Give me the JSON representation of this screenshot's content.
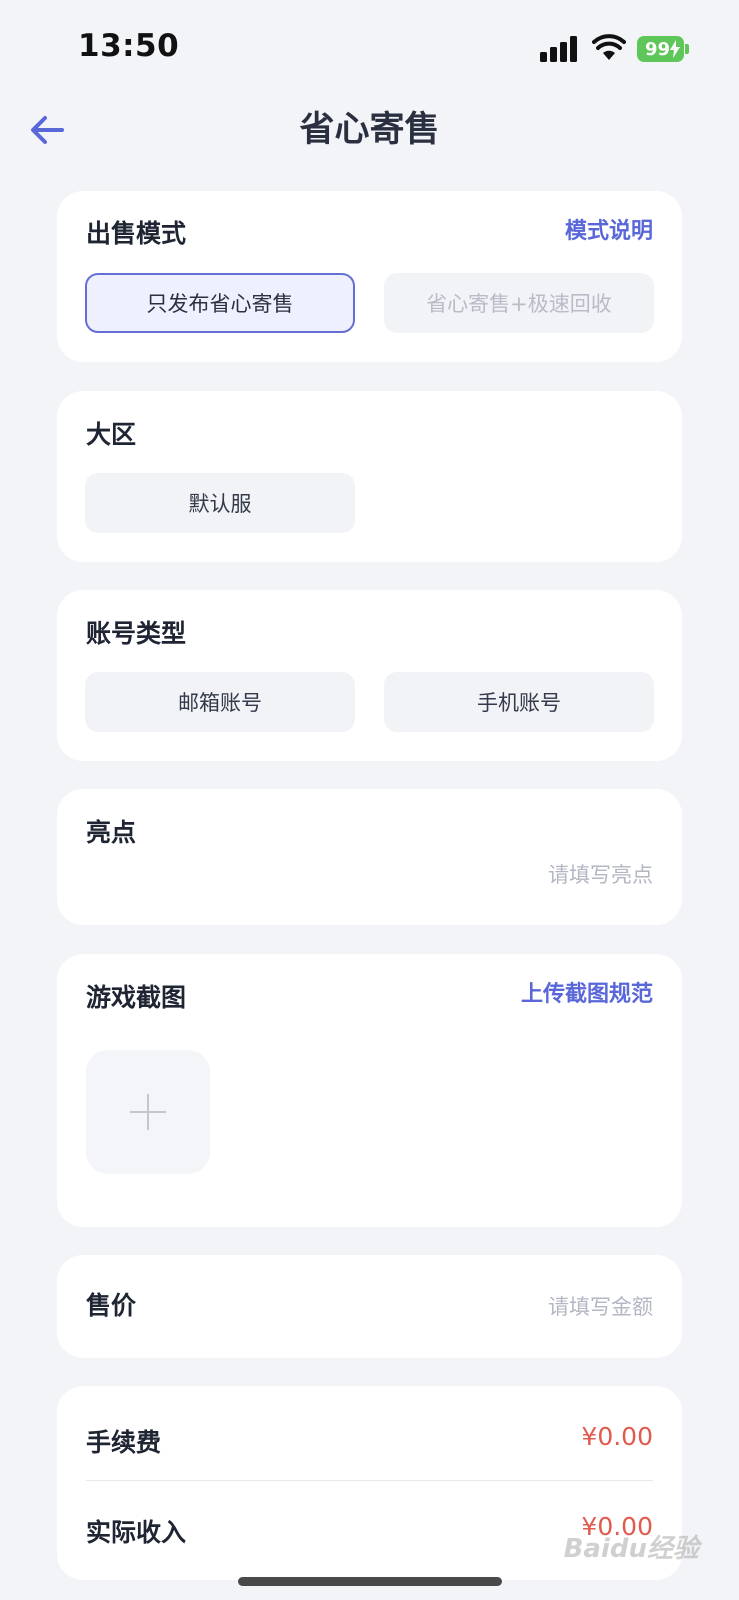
{
  "status": {
    "time": "13:50",
    "battery": "99"
  },
  "nav": {
    "title": "省心寄售"
  },
  "sale_mode": {
    "title": "出售模式",
    "link": "模式说明",
    "options": [
      "只发布省心寄售",
      "省心寄售+极速回收"
    ]
  },
  "region": {
    "title": "大区",
    "option": "默认服"
  },
  "account_type": {
    "title": "账号类型",
    "options": [
      "邮箱账号",
      "手机账号"
    ]
  },
  "highlight": {
    "title": "亮点",
    "placeholder": "请填写亮点"
  },
  "screenshots": {
    "title": "游戏截图",
    "link": "上传截图规范"
  },
  "price": {
    "title": "售价",
    "placeholder": "请填写金额"
  },
  "fees": {
    "fee_label": "手续费",
    "fee_value": "¥0.00",
    "income_label": "实际收入",
    "income_value": "¥0.00"
  },
  "watermark": "Baidu经验",
  "colors": {
    "accent": "#5a67d8",
    "price_red": "#e05a4e",
    "battery_green": "#5fc75a"
  }
}
